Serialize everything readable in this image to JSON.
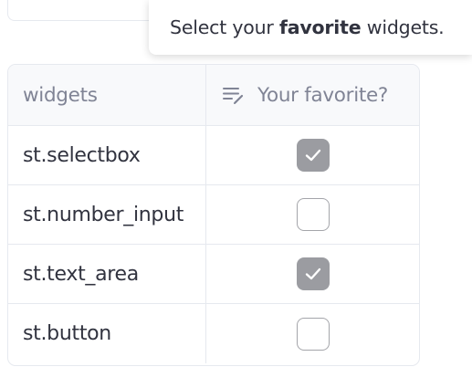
{
  "tooltip": {
    "prefix": "Select your ",
    "emphasis": "favorite",
    "suffix": " widgets."
  },
  "table": {
    "headers": {
      "name": "widgets",
      "favorite": "Your favorite?",
      "favorite_icon": "edit-list-icon"
    },
    "rows": [
      {
        "name": "st.selectbox",
        "favorite": true
      },
      {
        "name": "st.number_input",
        "favorite": false
      },
      {
        "name": "st.text_area",
        "favorite": true
      },
      {
        "name": "st.button",
        "favorite": false
      }
    ]
  },
  "colors": {
    "checked_fill": "#9b9ca1",
    "unchecked_border": "#a4a5aa",
    "grid_border": "#e6e9ef",
    "header_bg": "#f8f9fb",
    "text": "#31333f",
    "header_text": "#808495"
  }
}
